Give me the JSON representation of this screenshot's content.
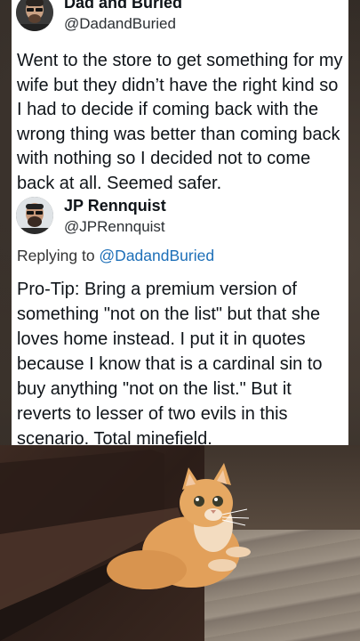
{
  "tweet1": {
    "display_name": "Dad and Buried",
    "handle": "@DadandBuried",
    "text": "Went to the store to get something for my wife but they didn’t have the right kind so I had to decide if coming back with the wrong thing was better than coming back with nothing so I decided not to come back at all. Seemed safer."
  },
  "tweet2": {
    "display_name": "JP Rennquist",
    "handle": "@JPRennquist",
    "replying_prefix": "Replying to ",
    "replying_to": "@DadandBuried",
    "text": "Pro-Tip: Bring a premium version of something \"not on the list\" but that she loves home instead. I put it in quotes because I know that is a cardinal sin to buy anything \"not on the list.\" But it reverts to lesser of two evils in this scenario. Total minefield."
  },
  "colors": {
    "mention": "#1d6fb8",
    "card_bg": "#ffffff",
    "cat_fur": "#e2a05a"
  },
  "icons": [
    "avatar-dad-and-buried",
    "avatar-jp-rennquist"
  ]
}
